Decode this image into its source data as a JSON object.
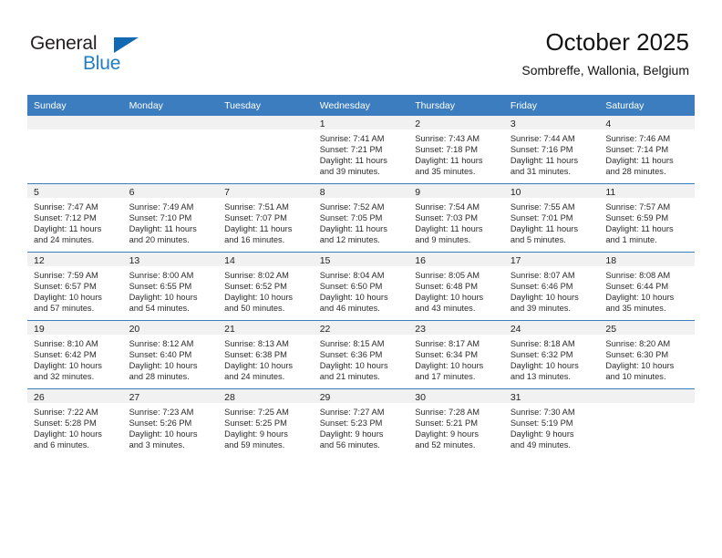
{
  "brand": {
    "name_part1": "General",
    "name_part2": "Blue",
    "accent_color": "#1f7ec4",
    "triangle_color": "#1268b3"
  },
  "header": {
    "title": "October 2025",
    "subtitle": "Sombreffe, Wallonia, Belgium"
  },
  "calendar": {
    "header_bg": "#3b7dbf",
    "daynum_bg": "#f1f1f1",
    "weekday_headers": [
      "Sunday",
      "Monday",
      "Tuesday",
      "Wednesday",
      "Thursday",
      "Friday",
      "Saturday"
    ],
    "weeks": [
      [
        {
          "day": "",
          "blank": true,
          "sunrise": "",
          "sunset": "",
          "daylight1": "",
          "daylight2": ""
        },
        {
          "day": "",
          "blank": true,
          "sunrise": "",
          "sunset": "",
          "daylight1": "",
          "daylight2": ""
        },
        {
          "day": "",
          "blank": true,
          "sunrise": "",
          "sunset": "",
          "daylight1": "",
          "daylight2": ""
        },
        {
          "day": "1",
          "blank": false,
          "sunrise": "Sunrise: 7:41 AM",
          "sunset": "Sunset: 7:21 PM",
          "daylight1": "Daylight: 11 hours",
          "daylight2": "and 39 minutes."
        },
        {
          "day": "2",
          "blank": false,
          "sunrise": "Sunrise: 7:43 AM",
          "sunset": "Sunset: 7:18 PM",
          "daylight1": "Daylight: 11 hours",
          "daylight2": "and 35 minutes."
        },
        {
          "day": "3",
          "blank": false,
          "sunrise": "Sunrise: 7:44 AM",
          "sunset": "Sunset: 7:16 PM",
          "daylight1": "Daylight: 11 hours",
          "daylight2": "and 31 minutes."
        },
        {
          "day": "4",
          "blank": false,
          "sunrise": "Sunrise: 7:46 AM",
          "sunset": "Sunset: 7:14 PM",
          "daylight1": "Daylight: 11 hours",
          "daylight2": "and 28 minutes."
        }
      ],
      [
        {
          "day": "5",
          "blank": false,
          "sunrise": "Sunrise: 7:47 AM",
          "sunset": "Sunset: 7:12 PM",
          "daylight1": "Daylight: 11 hours",
          "daylight2": "and 24 minutes."
        },
        {
          "day": "6",
          "blank": false,
          "sunrise": "Sunrise: 7:49 AM",
          "sunset": "Sunset: 7:10 PM",
          "daylight1": "Daylight: 11 hours",
          "daylight2": "and 20 minutes."
        },
        {
          "day": "7",
          "blank": false,
          "sunrise": "Sunrise: 7:51 AM",
          "sunset": "Sunset: 7:07 PM",
          "daylight1": "Daylight: 11 hours",
          "daylight2": "and 16 minutes."
        },
        {
          "day": "8",
          "blank": false,
          "sunrise": "Sunrise: 7:52 AM",
          "sunset": "Sunset: 7:05 PM",
          "daylight1": "Daylight: 11 hours",
          "daylight2": "and 12 minutes."
        },
        {
          "day": "9",
          "blank": false,
          "sunrise": "Sunrise: 7:54 AM",
          "sunset": "Sunset: 7:03 PM",
          "daylight1": "Daylight: 11 hours",
          "daylight2": "and 9 minutes."
        },
        {
          "day": "10",
          "blank": false,
          "sunrise": "Sunrise: 7:55 AM",
          "sunset": "Sunset: 7:01 PM",
          "daylight1": "Daylight: 11 hours",
          "daylight2": "and 5 minutes."
        },
        {
          "day": "11",
          "blank": false,
          "sunrise": "Sunrise: 7:57 AM",
          "sunset": "Sunset: 6:59 PM",
          "daylight1": "Daylight: 11 hours",
          "daylight2": "and 1 minute."
        }
      ],
      [
        {
          "day": "12",
          "blank": false,
          "sunrise": "Sunrise: 7:59 AM",
          "sunset": "Sunset: 6:57 PM",
          "daylight1": "Daylight: 10 hours",
          "daylight2": "and 57 minutes."
        },
        {
          "day": "13",
          "blank": false,
          "sunrise": "Sunrise: 8:00 AM",
          "sunset": "Sunset: 6:55 PM",
          "daylight1": "Daylight: 10 hours",
          "daylight2": "and 54 minutes."
        },
        {
          "day": "14",
          "blank": false,
          "sunrise": "Sunrise: 8:02 AM",
          "sunset": "Sunset: 6:52 PM",
          "daylight1": "Daylight: 10 hours",
          "daylight2": "and 50 minutes."
        },
        {
          "day": "15",
          "blank": false,
          "sunrise": "Sunrise: 8:04 AM",
          "sunset": "Sunset: 6:50 PM",
          "daylight1": "Daylight: 10 hours",
          "daylight2": "and 46 minutes."
        },
        {
          "day": "16",
          "blank": false,
          "sunrise": "Sunrise: 8:05 AM",
          "sunset": "Sunset: 6:48 PM",
          "daylight1": "Daylight: 10 hours",
          "daylight2": "and 43 minutes."
        },
        {
          "day": "17",
          "blank": false,
          "sunrise": "Sunrise: 8:07 AM",
          "sunset": "Sunset: 6:46 PM",
          "daylight1": "Daylight: 10 hours",
          "daylight2": "and 39 minutes."
        },
        {
          "day": "18",
          "blank": false,
          "sunrise": "Sunrise: 8:08 AM",
          "sunset": "Sunset: 6:44 PM",
          "daylight1": "Daylight: 10 hours",
          "daylight2": "and 35 minutes."
        }
      ],
      [
        {
          "day": "19",
          "blank": false,
          "sunrise": "Sunrise: 8:10 AM",
          "sunset": "Sunset: 6:42 PM",
          "daylight1": "Daylight: 10 hours",
          "daylight2": "and 32 minutes."
        },
        {
          "day": "20",
          "blank": false,
          "sunrise": "Sunrise: 8:12 AM",
          "sunset": "Sunset: 6:40 PM",
          "daylight1": "Daylight: 10 hours",
          "daylight2": "and 28 minutes."
        },
        {
          "day": "21",
          "blank": false,
          "sunrise": "Sunrise: 8:13 AM",
          "sunset": "Sunset: 6:38 PM",
          "daylight1": "Daylight: 10 hours",
          "daylight2": "and 24 minutes."
        },
        {
          "day": "22",
          "blank": false,
          "sunrise": "Sunrise: 8:15 AM",
          "sunset": "Sunset: 6:36 PM",
          "daylight1": "Daylight: 10 hours",
          "daylight2": "and 21 minutes."
        },
        {
          "day": "23",
          "blank": false,
          "sunrise": "Sunrise: 8:17 AM",
          "sunset": "Sunset: 6:34 PM",
          "daylight1": "Daylight: 10 hours",
          "daylight2": "and 17 minutes."
        },
        {
          "day": "24",
          "blank": false,
          "sunrise": "Sunrise: 8:18 AM",
          "sunset": "Sunset: 6:32 PM",
          "daylight1": "Daylight: 10 hours",
          "daylight2": "and 13 minutes."
        },
        {
          "day": "25",
          "blank": false,
          "sunrise": "Sunrise: 8:20 AM",
          "sunset": "Sunset: 6:30 PM",
          "daylight1": "Daylight: 10 hours",
          "daylight2": "and 10 minutes."
        }
      ],
      [
        {
          "day": "26",
          "blank": false,
          "sunrise": "Sunrise: 7:22 AM",
          "sunset": "Sunset: 5:28 PM",
          "daylight1": "Daylight: 10 hours",
          "daylight2": "and 6 minutes."
        },
        {
          "day": "27",
          "blank": false,
          "sunrise": "Sunrise: 7:23 AM",
          "sunset": "Sunset: 5:26 PM",
          "daylight1": "Daylight: 10 hours",
          "daylight2": "and 3 minutes."
        },
        {
          "day": "28",
          "blank": false,
          "sunrise": "Sunrise: 7:25 AM",
          "sunset": "Sunset: 5:25 PM",
          "daylight1": "Daylight: 9 hours",
          "daylight2": "and 59 minutes."
        },
        {
          "day": "29",
          "blank": false,
          "sunrise": "Sunrise: 7:27 AM",
          "sunset": "Sunset: 5:23 PM",
          "daylight1": "Daylight: 9 hours",
          "daylight2": "and 56 minutes."
        },
        {
          "day": "30",
          "blank": false,
          "sunrise": "Sunrise: 7:28 AM",
          "sunset": "Sunset: 5:21 PM",
          "daylight1": "Daylight: 9 hours",
          "daylight2": "and 52 minutes."
        },
        {
          "day": "31",
          "blank": false,
          "sunrise": "Sunrise: 7:30 AM",
          "sunset": "Sunset: 5:19 PM",
          "daylight1": "Daylight: 9 hours",
          "daylight2": "and 49 minutes."
        },
        {
          "day": "",
          "blank": true,
          "sunrise": "",
          "sunset": "",
          "daylight1": "",
          "daylight2": ""
        }
      ]
    ]
  }
}
